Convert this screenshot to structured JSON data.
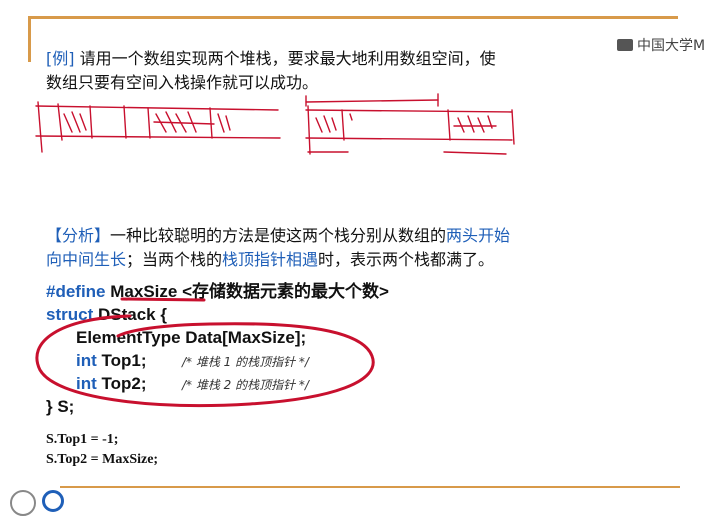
{
  "header": {
    "logo_text": "中国大学M"
  },
  "example": {
    "tag": "[例]",
    "text_line1": " 请用一个数组实现两个堆栈，要求最大地利用数组空间，使",
    "text_line2": "数组只要有空间入栈操作就可以成功。"
  },
  "analysis": {
    "tag": "【分析】",
    "part1": "一种比较聪明的方法是使这两个栈分别从数组的",
    "hl1": "两头开始",
    "line2_hl": "向中间生长",
    "part2": "；当两个栈的",
    "hl2": "栈顶指针相遇",
    "part3": "时，表示两个栈都满了。"
  },
  "code": {
    "define_kw": "#define",
    "define_rest": " MaxSize <存储数据元素的最大个数>",
    "struct_kw": "struct",
    "struct_rest": " DStack {",
    "data_line": "ElementType Data[MaxSize];",
    "int_kw1": "int",
    "top1": " Top1;",
    "comment1": "/* 堆栈 1 的栈顶指针 */",
    "int_kw2": "int",
    "top2": " Top2;",
    "comment2": "/* 堆栈 2 的栈顶指针 */",
    "close": "} S;"
  },
  "init": {
    "line1": "S.Top1 =  -1;",
    "line2": "S.Top2 = MaxSize;"
  },
  "colors": {
    "accent_blue": "#1f5fb8",
    "rule_orange": "#d89a4a",
    "annotation_red": "#c8102e"
  },
  "icons": {
    "bottom_left": [
      "university-seal-icon",
      "course-logo-icon"
    ]
  }
}
